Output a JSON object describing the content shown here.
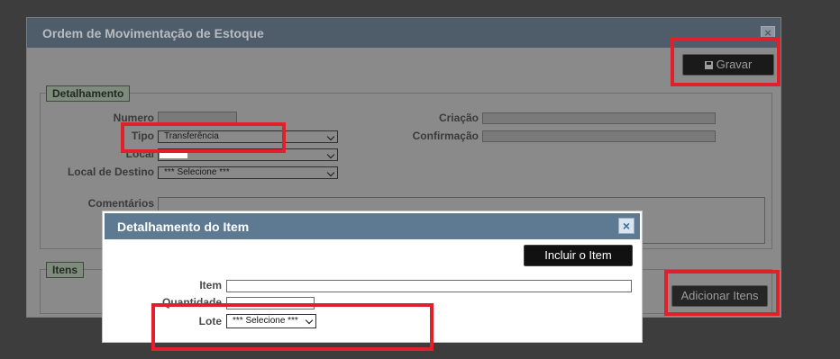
{
  "main_dialog": {
    "title": "Ordem de Movimentação de Estoque",
    "close_glyph": "×",
    "save_label": "Gravar",
    "save_icon": "save-icon",
    "detalhamento": {
      "legend": "Detalhamento",
      "numero_label": "Numero",
      "tipo_label": "Tipo",
      "tipo_value": "Transferência",
      "local_label": "Local",
      "local_destino_label": "Local de Destino",
      "local_destino_value": "*** Selecione ***",
      "criacao_label": "Criação",
      "confirmacao_label": "Confirmação",
      "comentarios_label": "Comentários"
    },
    "itens": {
      "legend": "Itens",
      "add_label": "Adicionar Itens"
    }
  },
  "item_dialog": {
    "title": "Detalhamento do Item",
    "close_glyph": "×",
    "include_label": "Incluir o Item",
    "item_label": "Item",
    "quantidade_label": "Quantidade",
    "lote_label": "Lote",
    "lote_value": "*** Selecione ***"
  },
  "colors": {
    "highlight": "#e0202a",
    "item_title_bar": "#5e7a93",
    "main_title_bar": "#4f5d6a",
    "overlay": "#3d3d3d"
  }
}
